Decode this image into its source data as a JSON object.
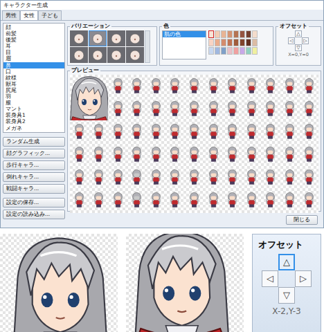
{
  "window": {
    "title": "キャラクター生成",
    "close_button": "閉じる"
  },
  "tabs": [
    {
      "label": "男性",
      "selected": false
    },
    {
      "label": "女性",
      "selected": true
    },
    {
      "label": "子ども",
      "selected": false
    }
  ],
  "parts": [
    {
      "label": "顔",
      "selected": false
    },
    {
      "label": "前髪",
      "selected": false
    },
    {
      "label": "後髪",
      "selected": false
    },
    {
      "label": "耳",
      "selected": false
    },
    {
      "label": "目",
      "selected": false
    },
    {
      "label": "眉",
      "selected": false
    },
    {
      "label": "鼻",
      "selected": true
    },
    {
      "label": "口",
      "selected": false
    },
    {
      "label": "紋様",
      "selected": false
    },
    {
      "label": "獣耳",
      "selected": false
    },
    {
      "label": "尻尾",
      "selected": false
    },
    {
      "label": "羽",
      "selected": false
    },
    {
      "label": "服",
      "selected": false
    },
    {
      "label": "マント",
      "selected": false
    },
    {
      "label": "装身具1",
      "selected": false
    },
    {
      "label": "装身具2",
      "selected": false
    },
    {
      "label": "メガネ",
      "selected": false
    }
  ],
  "actions": [
    "ランダム生成",
    "顔グラフィック...",
    "歩行キャラ...",
    "倒れキャラ...",
    "戦闘キャラ..."
  ],
  "file_buttons": [
    "設定の保存...",
    "設定の読み込み..."
  ],
  "variation": {
    "title": "バリエーション",
    "items": [
      {
        "selected": false
      },
      {
        "selected": true
      },
      {
        "selected": false
      },
      {
        "selected": false
      },
      {
        "selected": false
      },
      {
        "selected": false
      },
      {
        "selected": false
      },
      {
        "selected": false
      }
    ]
  },
  "color": {
    "title": "色",
    "items": [
      {
        "label": "肌の色",
        "selected": true
      }
    ],
    "palette": [
      {
        "color": "#f8e4d6",
        "selected": true
      },
      {
        "color": "#f2ccb4",
        "selected": false
      },
      {
        "color": "#e8b494",
        "selected": false
      },
      {
        "color": "#d49474",
        "selected": false
      },
      {
        "color": "#b47454",
        "selected": false
      },
      {
        "color": "#945440",
        "selected": false
      },
      {
        "color": "#744030",
        "selected": false
      },
      {
        "color": "#f4dccc",
        "selected": false
      },
      {
        "color": "#f8d4c4",
        "selected": false
      },
      {
        "color": "#eaac8c",
        "selected": false
      },
      {
        "color": "#d48c6c",
        "selected": false
      },
      {
        "color": "#c07454",
        "selected": false
      },
      {
        "color": "#a05c3c",
        "selected": false
      },
      {
        "color": "#80442c",
        "selected": false
      },
      {
        "color": "#603020",
        "selected": false
      },
      {
        "color": "#dcbca4",
        "selected": false
      },
      {
        "color": "#c8d8f0",
        "selected": false
      },
      {
        "color": "#a0b8e0",
        "selected": false
      },
      {
        "color": "#80a0c8",
        "selected": false
      },
      {
        "color": "#e8c0c8",
        "selected": false
      },
      {
        "color": "#f0a0a0",
        "selected": false
      },
      {
        "color": "#c8a8e8",
        "selected": false
      },
      {
        "color": "#90d0c0",
        "selected": false
      },
      {
        "color": "#f0f0a0",
        "selected": false
      }
    ]
  },
  "offset": {
    "title": "オフセット",
    "reading": "X=0,Y=0",
    "arrows": [
      {
        "label": "△",
        "kind": "up",
        "selected": false
      },
      {
        "label": "◁",
        "kind": "left",
        "selected": false
      },
      {
        "label": "▷",
        "kind": "right",
        "selected": false
      },
      {
        "label": "▽",
        "kind": "down",
        "selected": false
      }
    ]
  },
  "preview": {
    "title": "プレビュー"
  },
  "zoom": {
    "title": "オフセット",
    "reading": "X-2,Y-3",
    "arrows": [
      {
        "label": "△",
        "kind": "up",
        "selected": true
      },
      {
        "label": "◁",
        "kind": "left",
        "selected": false
      },
      {
        "label": "▷",
        "kind": "right",
        "selected": false
      },
      {
        "label": "▽",
        "kind": "down",
        "selected": false
      }
    ]
  }
}
